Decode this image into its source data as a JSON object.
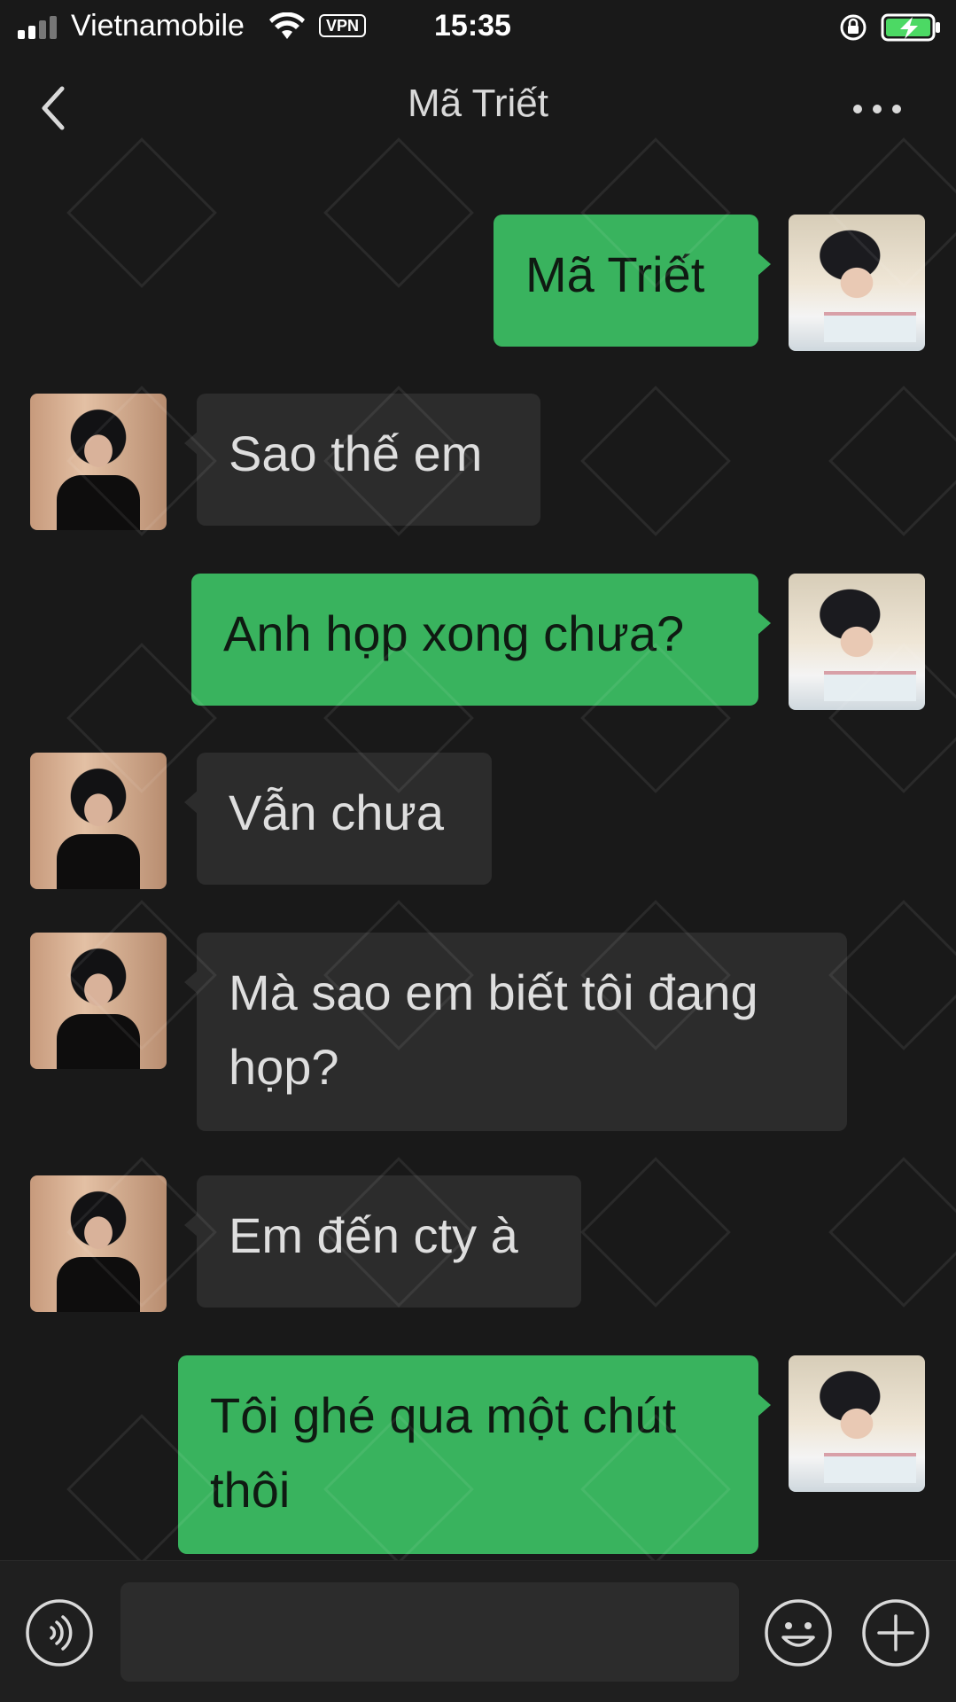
{
  "status_bar": {
    "carrier": "Vietnamobile",
    "vpn": "VPN",
    "time": "15:35",
    "signal_icon": "signal-bars-icon",
    "wifi_icon": "wifi-icon",
    "rotation_lock_icon": "rotation-lock-icon",
    "battery_icon": "battery-charging-icon"
  },
  "header": {
    "title": "Mã Triết",
    "back_icon": "chevron-left-icon",
    "more_icon": "more-dots-icon"
  },
  "messages": [
    {
      "sender": "me",
      "text": "Mã Triết"
    },
    {
      "sender": "other",
      "text": "Sao thế em"
    },
    {
      "sender": "me",
      "text": "Anh họp xong chưa?"
    },
    {
      "sender": "other",
      "text": "Vẫn chưa"
    },
    {
      "sender": "other",
      "text": "Mà sao em biết tôi đang họp?"
    },
    {
      "sender": "other",
      "text": "Em đến cty à"
    },
    {
      "sender": "me",
      "text": "Tôi ghé qua một chút thôi"
    }
  ],
  "input_bar": {
    "voice_icon": "voice-icon",
    "input_value": "",
    "emoji_icon": "emoji-icon",
    "plus_icon": "plus-icon"
  },
  "colors": {
    "background": "#191919",
    "outgoing_bubble": "#39b35e",
    "incoming_bubble": "#2c2c2c",
    "input_bar": "#1f1f1f"
  }
}
